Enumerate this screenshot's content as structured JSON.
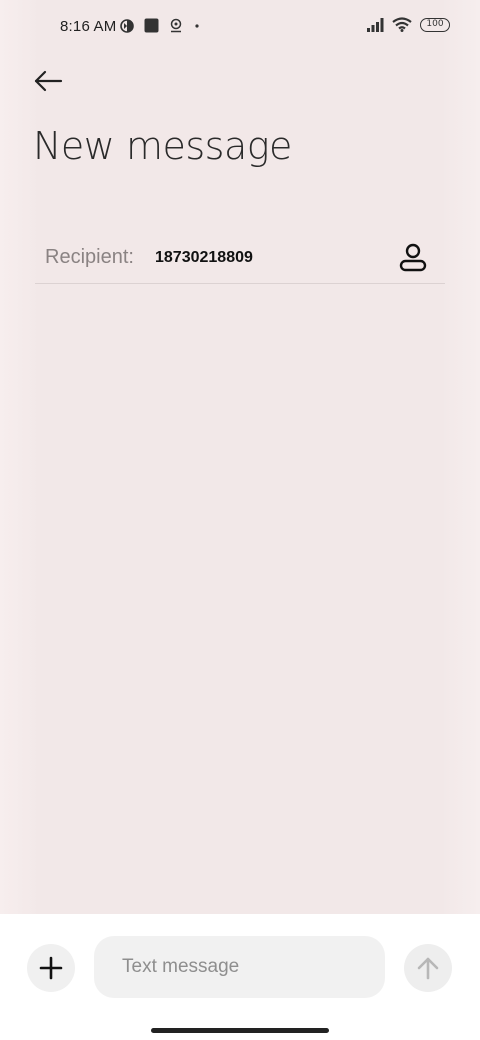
{
  "status_bar": {
    "time": "8:16 AM",
    "battery": "100",
    "icons_left": [
      "data-saver-icon",
      "app-notification-icon",
      "location-badge-icon",
      "dot-icon"
    ],
    "icons_right": [
      "signal-icon",
      "wifi-icon",
      "battery-icon"
    ]
  },
  "header": {
    "back_icon": "arrow-left-icon",
    "title": "New message"
  },
  "recipient": {
    "label": "Recipient:",
    "value": "18730218809",
    "contact_icon": "person-icon"
  },
  "composer": {
    "add_icon": "plus-icon",
    "placeholder": "Text message",
    "value": "",
    "send_icon": "arrow-up-icon"
  },
  "colors": {
    "background": "#f2e8e8",
    "composer_bg": "#ffffff",
    "input_bg": "#f1f1f1",
    "send_disabled": "#b7b7b7"
  }
}
